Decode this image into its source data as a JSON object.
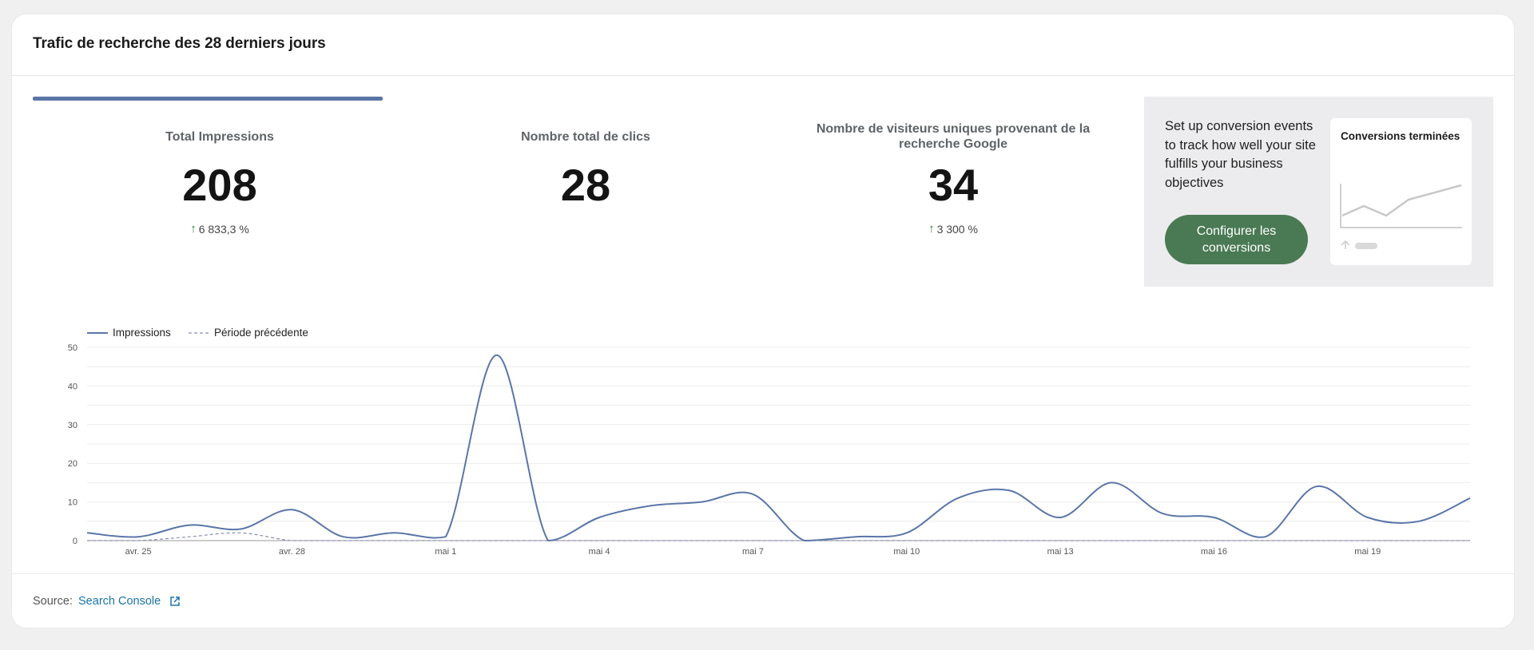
{
  "header": {
    "title": "Trafic de recherche des 28 derniers jours"
  },
  "metrics": [
    {
      "label": "Total Impressions",
      "value": "208",
      "change": "6 833,3 %",
      "trend": "up"
    },
    {
      "label": "Nombre total de clics",
      "value": "28",
      "change": "",
      "trend": ""
    },
    {
      "label": "Nombre de visiteurs uniques provenant de la recherche Google",
      "value": "34",
      "change": "3 300 %",
      "trend": "up"
    }
  ],
  "conversion": {
    "text": "Set up conversion events to track how well your site fulfills your business objectives",
    "button_label": "Configurer les conversions",
    "mini_title": "Conversions terminées"
  },
  "footer": {
    "source_label": "Source:",
    "source_link": "Search Console"
  },
  "colors": {
    "accent": "#5a76a8",
    "button": "#4a7a53",
    "up": "#2e7d32",
    "link": "#1a73a8"
  },
  "icons": {
    "trend": "arrow-up-icon",
    "external": "external-link-icon"
  },
  "chart_data": {
    "type": "line",
    "legend_position": "top-left",
    "grid": true,
    "ylim": [
      0,
      50
    ],
    "yticks": [
      0,
      10,
      20,
      30,
      40,
      50
    ],
    "x": [
      "avr. 24",
      "avr. 25",
      "avr. 26",
      "avr. 27",
      "avr. 28",
      "avr. 29",
      "avr. 30",
      "mai 1",
      "mai 2",
      "mai 3",
      "mai 4",
      "mai 5",
      "mai 6",
      "mai 7",
      "mai 8",
      "mai 9",
      "mai 10",
      "mai 11",
      "mai 12",
      "mai 13",
      "mai 14",
      "mai 15",
      "mai 16",
      "mai 17",
      "mai 18",
      "mai 19",
      "mai 20",
      "mai 21"
    ],
    "xticks": [
      "avr. 25",
      "avr. 28",
      "mai 1",
      "mai 4",
      "mai 7",
      "mai 10",
      "mai 13",
      "mai 16",
      "mai 19"
    ],
    "series": [
      {
        "name": "Impressions",
        "style": "solid",
        "color": "#5a76a8",
        "values": [
          2,
          1,
          4,
          3,
          8,
          1,
          2,
          1,
          48,
          0,
          6,
          9,
          10,
          12,
          0,
          1,
          2,
          11,
          13,
          6,
          15,
          7,
          6,
          1,
          14,
          6,
          5,
          11
        ]
      },
      {
        "name": "Période précédente",
        "style": "dashed",
        "color": "#8a8fb0",
        "values": [
          0,
          0,
          1,
          2,
          0,
          0,
          0,
          0,
          0,
          0,
          0,
          0,
          0,
          0,
          0,
          0,
          0,
          0,
          0,
          0,
          0,
          0,
          0,
          0,
          0,
          0,
          0,
          0
        ]
      }
    ]
  }
}
